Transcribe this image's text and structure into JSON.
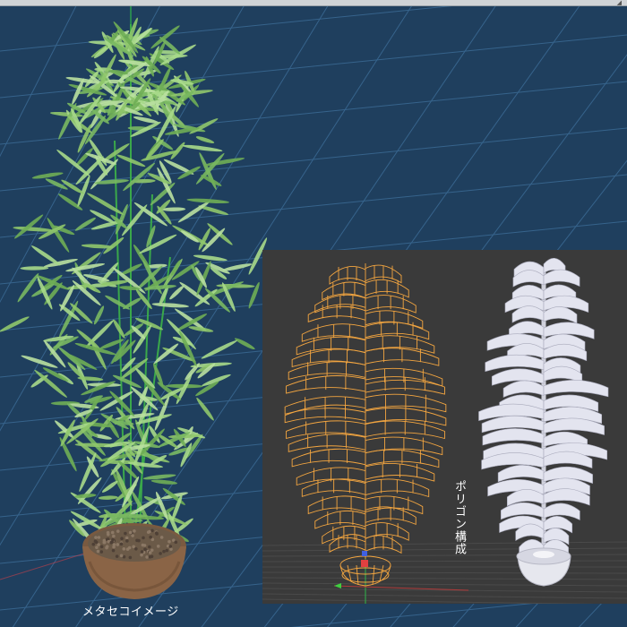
{
  "main_viewport": {
    "caption": "メタセコイメージ"
  },
  "inset_viewport": {
    "label": "ポリゴン構成"
  },
  "colors": {
    "viewport_bg": "#1f3f5e",
    "grid_line": "#3b6a94",
    "inset_bg": "#3a3a3a",
    "wireframe": "#f4a640",
    "leaf_green": "#8fc76b",
    "stem_green": "#3aa84a",
    "pot_brown": "#8a6446",
    "soil": "#6b5a48",
    "solid_leaf": "#e3e4ef"
  }
}
